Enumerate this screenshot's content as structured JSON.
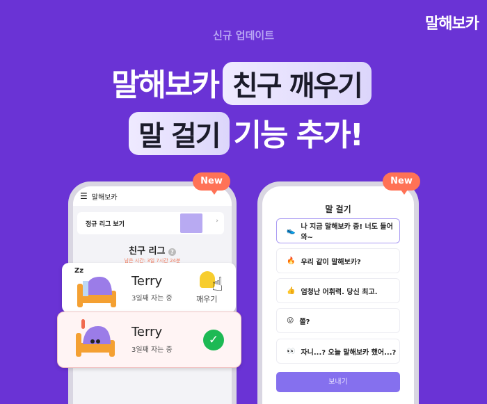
{
  "logo": "말해보카",
  "subtitle": "신규 업데이트",
  "headline": {
    "line1_plain": "말해보카",
    "line1_pill": "친구 깨우기",
    "line2_pill": "말 걸기",
    "line2_plain": "기능 추가!"
  },
  "badge": "New",
  "left_phone": {
    "app_title": "말해보카",
    "league_link": "정규 리그 보기",
    "section_title": "친구 리그",
    "remaining": "남은 시간: 3일 7시간 24분",
    "cards": [
      {
        "name": "Terry",
        "status": "3일째 자는 중",
        "action": "깨우기"
      },
      {
        "name": "Terry",
        "status": "3일째 자는 중"
      }
    ]
  },
  "right_phone": {
    "title": "말 걸기",
    "options": [
      {
        "emoji": "👟",
        "text": "나 지금 말해보카 중! 너도 들어와~",
        "selected": true
      },
      {
        "emoji": "🔥",
        "text": "우리 같이 말해보카?"
      },
      {
        "emoji": "👍",
        "text": "엄청난 어휘력. 당신 최고."
      },
      {
        "emoji": "😛",
        "text": "쫄?"
      },
      {
        "emoji": "👀",
        "text": "자니...? 오늘 말해보카 했어...?"
      }
    ],
    "send": "보내기"
  },
  "colors": {
    "background": "#6a33d5",
    "badge": "#ff7256",
    "send_button": "#8570ee",
    "check": "#1db954"
  }
}
